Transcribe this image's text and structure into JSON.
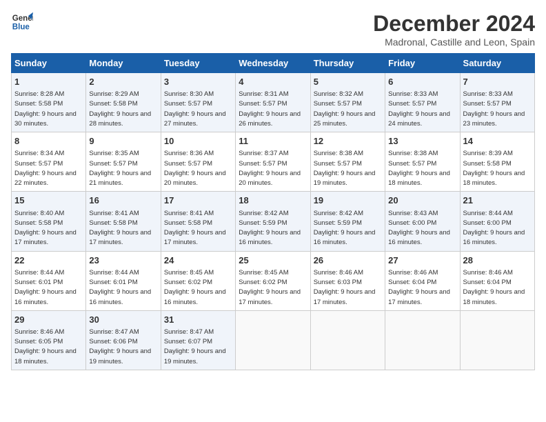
{
  "header": {
    "logo_line1": "General",
    "logo_line2": "Blue",
    "month_title": "December 2024",
    "location": "Madronal, Castille and Leon, Spain"
  },
  "weekdays": [
    "Sunday",
    "Monday",
    "Tuesday",
    "Wednesday",
    "Thursday",
    "Friday",
    "Saturday"
  ],
  "weeks": [
    [
      {
        "day": "1",
        "sunrise": "8:28 AM",
        "sunset": "5:58 PM",
        "daylight": "9 hours and 30 minutes."
      },
      {
        "day": "2",
        "sunrise": "8:29 AM",
        "sunset": "5:58 PM",
        "daylight": "9 hours and 28 minutes."
      },
      {
        "day": "3",
        "sunrise": "8:30 AM",
        "sunset": "5:57 PM",
        "daylight": "9 hours and 27 minutes."
      },
      {
        "day": "4",
        "sunrise": "8:31 AM",
        "sunset": "5:57 PM",
        "daylight": "9 hours and 26 minutes."
      },
      {
        "day": "5",
        "sunrise": "8:32 AM",
        "sunset": "5:57 PM",
        "daylight": "9 hours and 25 minutes."
      },
      {
        "day": "6",
        "sunrise": "8:33 AM",
        "sunset": "5:57 PM",
        "daylight": "9 hours and 24 minutes."
      },
      {
        "day": "7",
        "sunrise": "8:33 AM",
        "sunset": "5:57 PM",
        "daylight": "9 hours and 23 minutes."
      }
    ],
    [
      {
        "day": "8",
        "sunrise": "8:34 AM",
        "sunset": "5:57 PM",
        "daylight": "9 hours and 22 minutes."
      },
      {
        "day": "9",
        "sunrise": "8:35 AM",
        "sunset": "5:57 PM",
        "daylight": "9 hours and 21 minutes."
      },
      {
        "day": "10",
        "sunrise": "8:36 AM",
        "sunset": "5:57 PM",
        "daylight": "9 hours and 20 minutes."
      },
      {
        "day": "11",
        "sunrise": "8:37 AM",
        "sunset": "5:57 PM",
        "daylight": "9 hours and 20 minutes."
      },
      {
        "day": "12",
        "sunrise": "8:38 AM",
        "sunset": "5:57 PM",
        "daylight": "9 hours and 19 minutes."
      },
      {
        "day": "13",
        "sunrise": "8:38 AM",
        "sunset": "5:57 PM",
        "daylight": "9 hours and 18 minutes."
      },
      {
        "day": "14",
        "sunrise": "8:39 AM",
        "sunset": "5:58 PM",
        "daylight": "9 hours and 18 minutes."
      }
    ],
    [
      {
        "day": "15",
        "sunrise": "8:40 AM",
        "sunset": "5:58 PM",
        "daylight": "9 hours and 17 minutes."
      },
      {
        "day": "16",
        "sunrise": "8:41 AM",
        "sunset": "5:58 PM",
        "daylight": "9 hours and 17 minutes."
      },
      {
        "day": "17",
        "sunrise": "8:41 AM",
        "sunset": "5:58 PM",
        "daylight": "9 hours and 17 minutes."
      },
      {
        "day": "18",
        "sunrise": "8:42 AM",
        "sunset": "5:59 PM",
        "daylight": "9 hours and 16 minutes."
      },
      {
        "day": "19",
        "sunrise": "8:42 AM",
        "sunset": "5:59 PM",
        "daylight": "9 hours and 16 minutes."
      },
      {
        "day": "20",
        "sunrise": "8:43 AM",
        "sunset": "6:00 PM",
        "daylight": "9 hours and 16 minutes."
      },
      {
        "day": "21",
        "sunrise": "8:44 AM",
        "sunset": "6:00 PM",
        "daylight": "9 hours and 16 minutes."
      }
    ],
    [
      {
        "day": "22",
        "sunrise": "8:44 AM",
        "sunset": "6:01 PM",
        "daylight": "9 hours and 16 minutes."
      },
      {
        "day": "23",
        "sunrise": "8:44 AM",
        "sunset": "6:01 PM",
        "daylight": "9 hours and 16 minutes."
      },
      {
        "day": "24",
        "sunrise": "8:45 AM",
        "sunset": "6:02 PM",
        "daylight": "9 hours and 16 minutes."
      },
      {
        "day": "25",
        "sunrise": "8:45 AM",
        "sunset": "6:02 PM",
        "daylight": "9 hours and 17 minutes."
      },
      {
        "day": "26",
        "sunrise": "8:46 AM",
        "sunset": "6:03 PM",
        "daylight": "9 hours and 17 minutes."
      },
      {
        "day": "27",
        "sunrise": "8:46 AM",
        "sunset": "6:04 PM",
        "daylight": "9 hours and 17 minutes."
      },
      {
        "day": "28",
        "sunrise": "8:46 AM",
        "sunset": "6:04 PM",
        "daylight": "9 hours and 18 minutes."
      }
    ],
    [
      {
        "day": "29",
        "sunrise": "8:46 AM",
        "sunset": "6:05 PM",
        "daylight": "9 hours and 18 minutes."
      },
      {
        "day": "30",
        "sunrise": "8:47 AM",
        "sunset": "6:06 PM",
        "daylight": "9 hours and 19 minutes."
      },
      {
        "day": "31",
        "sunrise": "8:47 AM",
        "sunset": "6:07 PM",
        "daylight": "9 hours and 19 minutes."
      },
      null,
      null,
      null,
      null
    ]
  ]
}
